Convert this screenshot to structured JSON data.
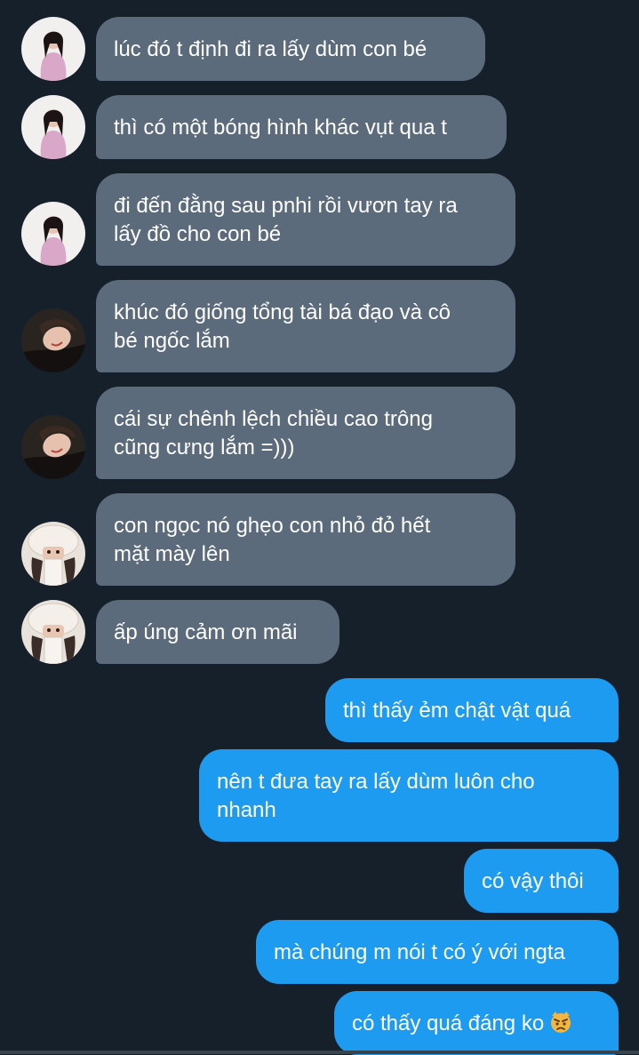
{
  "colors": {
    "background": "#15202b",
    "incoming_bubble": "#5b6b7c",
    "outgoing_bubble": "#1d9bf0",
    "text": "#ffffff"
  },
  "messages": [
    {
      "sender": "avatar-1",
      "direction": "incoming",
      "lines": [
        "lúc đó t định đi ra lấy dùm con bé"
      ]
    },
    {
      "sender": "avatar-1",
      "direction": "incoming",
      "lines": [
        "thì có một bóng hình khác vụt qua t"
      ]
    },
    {
      "sender": "avatar-1",
      "direction": "incoming",
      "lines": [
        "đi đến đằng sau pnhi rồi vươn tay ra",
        "lấy đồ cho con bé"
      ]
    },
    {
      "sender": "avatar-2",
      "direction": "incoming",
      "lines": [
        "khúc đó giống tổng tài bá đạo và cô",
        "bé ngốc lắm"
      ]
    },
    {
      "sender": "avatar-2",
      "direction": "incoming",
      "lines": [
        "cái sự chênh lệch chiều cao trông",
        "cũng cưng lắm =)))"
      ]
    },
    {
      "sender": "avatar-3",
      "direction": "incoming",
      "lines": [
        "con ngọc nó ghẹo con nhỏ đỏ hết",
        "mặt mày lên"
      ]
    },
    {
      "sender": "avatar-3",
      "direction": "incoming",
      "lines": [
        "ấp úng cảm ơn mãi"
      ]
    },
    {
      "sender": "me",
      "direction": "outgoing",
      "lines": [
        "thì thấy ẻm chật vật quá"
      ]
    },
    {
      "sender": "me",
      "direction": "outgoing",
      "lines": [
        "nên t đưa tay ra lấy dùm luôn cho",
        "nhanh"
      ]
    },
    {
      "sender": "me",
      "direction": "outgoing",
      "lines": [
        "có vậy thôi"
      ]
    },
    {
      "sender": "me",
      "direction": "outgoing",
      "lines": [
        "mà chúng m nói t có ý với ngta"
      ]
    },
    {
      "sender": "me",
      "direction": "outgoing",
      "lines": [
        "có thấy quá đáng ko"
      ],
      "emoji": "angry-cat-icon"
    }
  ]
}
